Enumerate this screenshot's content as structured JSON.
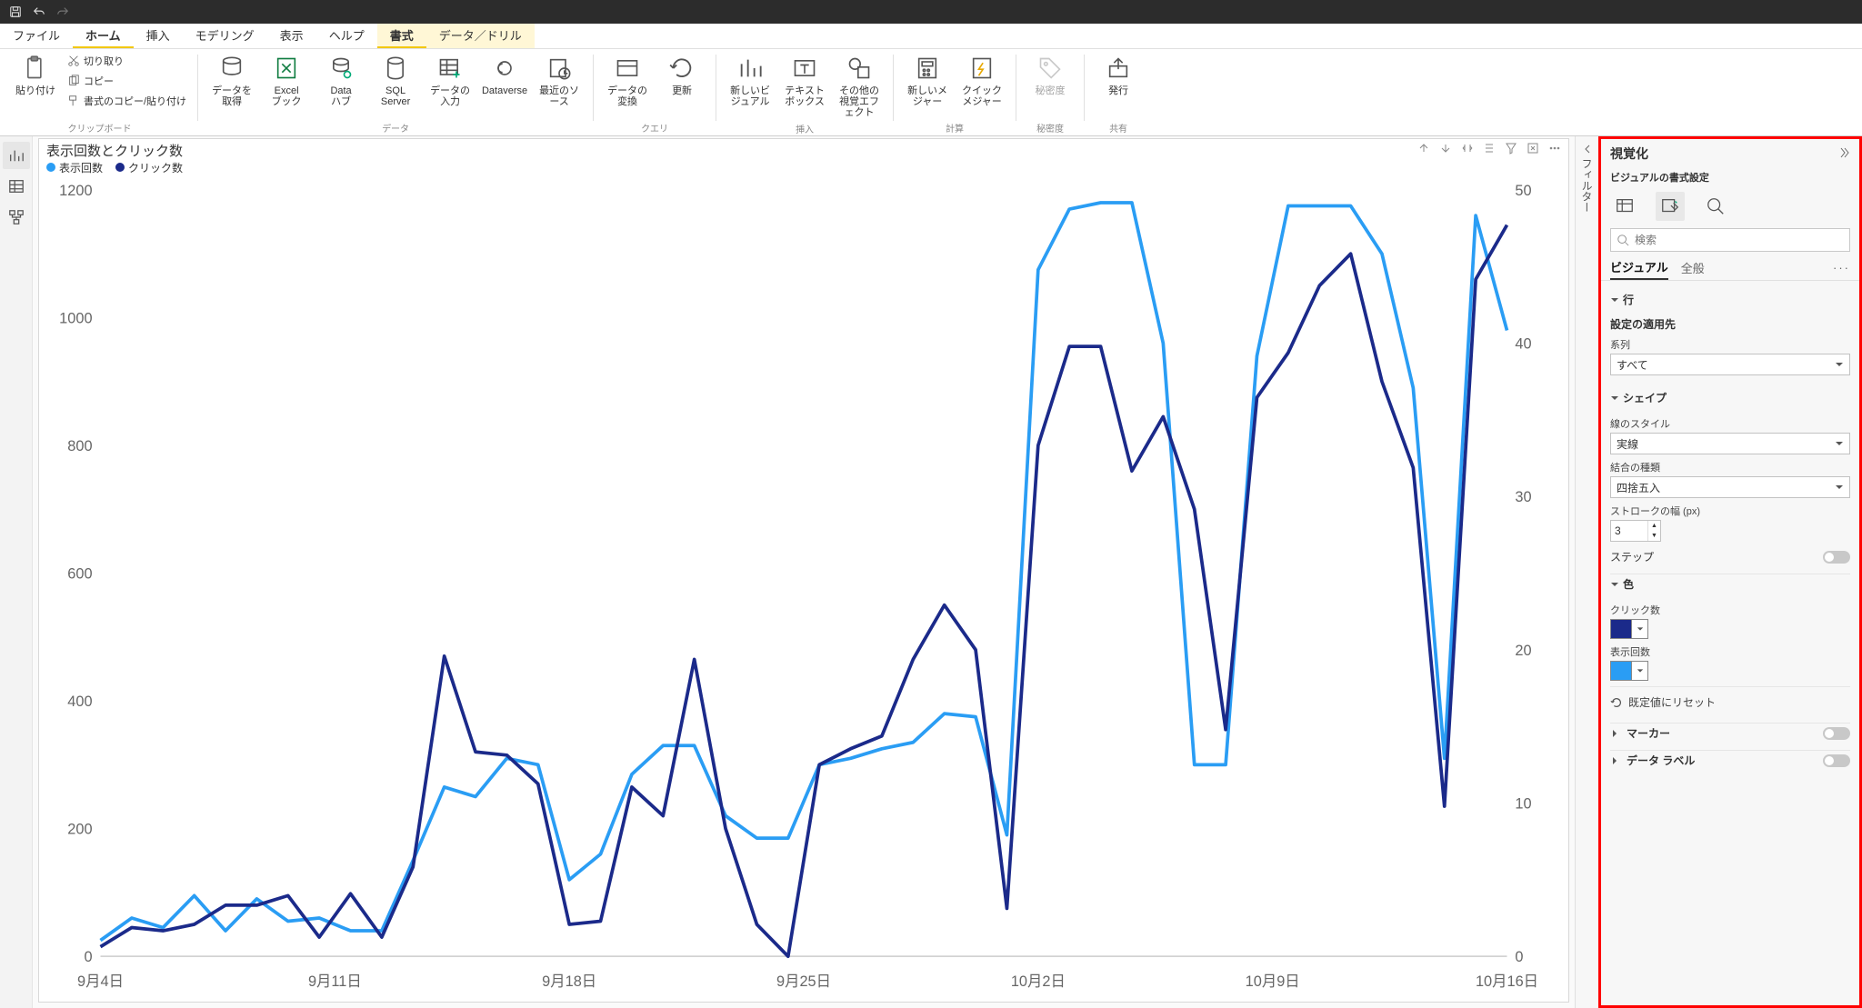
{
  "titlebar": {
    "save": "",
    "undo": "",
    "redo": ""
  },
  "tabs": {
    "file": "ファイル",
    "home": "ホーム",
    "insert": "挿入",
    "modeling": "モデリング",
    "view": "表示",
    "help": "ヘルプ",
    "format": "書式",
    "data_drill": "データ／ドリル"
  },
  "ribbon": {
    "clipboard": {
      "paste": "貼り付け",
      "cut": "切り取り",
      "copy": "コピー",
      "format_painter": "書式のコピー/貼り付け",
      "group": "クリップボード"
    },
    "data": {
      "get_data": "データを取得",
      "excel": "Excel\nブック",
      "datahub": "Data\nハブ",
      "sql": "SQL\nServer",
      "enter": "データの入力",
      "dataverse": "Dataverse",
      "recent": "最近のソース",
      "group": "データ"
    },
    "query": {
      "transform": "データの変換",
      "refresh": "更新",
      "group": "クエリ"
    },
    "insert": {
      "new_visual": "新しいビジュアル",
      "textbox": "テキスト\nボックス",
      "more": "その他の視覚エフェクト",
      "group": "挿入"
    },
    "calc": {
      "new_measure": "新しいメジャー",
      "quick": "クイック\nメジャー",
      "group": "計算"
    },
    "sensitivity": {
      "btn": "秘密度",
      "group": "秘密度"
    },
    "share": {
      "publish": "発行",
      "group": "共有"
    }
  },
  "leftrail": {
    "report": "",
    "data": "",
    "model": ""
  },
  "visual": {
    "title": "表示回数とクリック数",
    "legend_impressions": "表示回数",
    "legend_clicks": "クリック数"
  },
  "chart_data": {
    "type": "line",
    "x_categories": [
      "9月4日",
      "9月11日",
      "9月18日",
      "9月25日",
      "10月2日",
      "10月9日",
      "10月16日"
    ],
    "y_left": {
      "label": "",
      "range": [
        0,
        1200
      ],
      "ticks": [
        0,
        200,
        400,
        600,
        800,
        1000,
        1200
      ]
    },
    "y_right": {
      "label": "",
      "range": [
        0,
        50
      ],
      "ticks": [
        0,
        10,
        20,
        30,
        40,
        50
      ]
    },
    "series": [
      {
        "name": "表示回数",
        "axis": "left",
        "color": "#2a9df4",
        "values": [
          25,
          60,
          45,
          95,
          40,
          90,
          55,
          60,
          40,
          40,
          150,
          265,
          250,
          310,
          300,
          120,
          160,
          285,
          330,
          330,
          220,
          185,
          185,
          300,
          310,
          325,
          335,
          380,
          375,
          190,
          1075,
          1170,
          1180,
          1180,
          960,
          300,
          300,
          940,
          1175,
          1175,
          1175,
          1100,
          890,
          310,
          1160,
          980
        ]
      },
      {
        "name": "クリック数",
        "axis": "right",
        "color": "#1b2a8a",
        "values": [
          15,
          45,
          40,
          50,
          80,
          80,
          95,
          30,
          98,
          30,
          140,
          470,
          320,
          315,
          270,
          50,
          55,
          265,
          220,
          465,
          200,
          50,
          0,
          300,
          325,
          345,
          465,
          550,
          480,
          75,
          800,
          955,
          955,
          760,
          845,
          700,
          355,
          875,
          945,
          1050,
          1100,
          900,
          765,
          235,
          1060,
          1145
        ]
      }
    ]
  },
  "filter_pane": "フィルター",
  "viz_pane": {
    "title": "視覚化",
    "subtitle": "ビジュアルの書式設定",
    "search_placeholder": "検索",
    "tab_visual": "ビジュアル",
    "tab_general": "全般",
    "sec_lines": "行",
    "apply_to": "設定の適用先",
    "series_label": "系列",
    "series_value": "すべて",
    "sec_shape": "シェイプ",
    "line_style_label": "線のスタイル",
    "line_style_value": "実線",
    "join_label": "結合の種類",
    "join_value": "四捨五入",
    "stroke_label": "ストロークの幅 (px)",
    "stroke_value": "3",
    "step_label": "ステップ",
    "sec_color": "色",
    "color_clicks_label": "クリック数",
    "color_clicks": "#1b2a8a",
    "color_imp_label": "表示回数",
    "color_imp": "#2a9df4",
    "reset": "既定値にリセット",
    "sec_markers": "マーカー",
    "sec_data_labels": "データ ラベル"
  }
}
